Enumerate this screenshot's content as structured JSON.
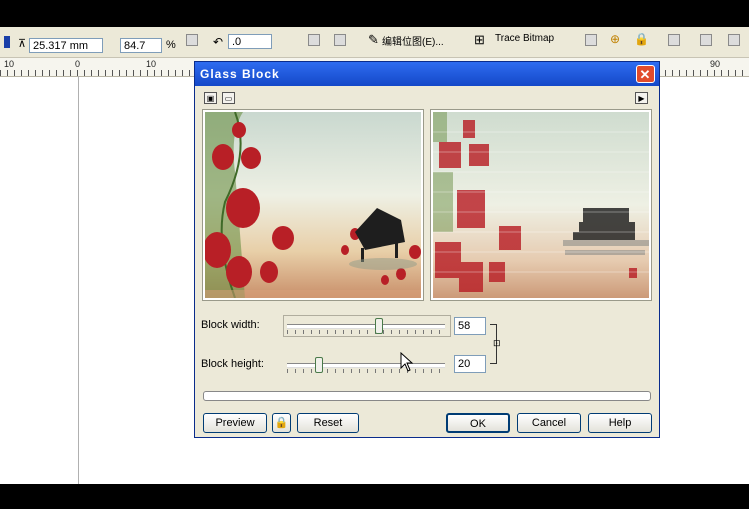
{
  "toolbar": {
    "y_value": "25.317 mm",
    "zoom": "84.7",
    "zoom_unit": "%",
    "rotate_value": ".0",
    "edit_bitmap_label": "编辑位图(E)...",
    "trace_bitmap_label": "Trace Bitmap"
  },
  "ruler": {
    "ticks": [
      "10",
      "0",
      "10",
      "90"
    ]
  },
  "dialog": {
    "title": "Glass Block",
    "close_glyph": "✕",
    "block_width_label": "Block width:",
    "block_width_value": "58",
    "block_width_fraction": 0.58,
    "block_height_label": "Block height:",
    "block_height_value": "20",
    "block_height_fraction": 0.2,
    "preview_label": "Preview",
    "reset_label": "Reset",
    "ok_label": "OK",
    "cancel_label": "Cancel",
    "help_label": "Help"
  },
  "colors": {
    "title_bar": "#1448c8",
    "dialog_bg": "#ece9d8",
    "close_button": "#e14b2b"
  }
}
